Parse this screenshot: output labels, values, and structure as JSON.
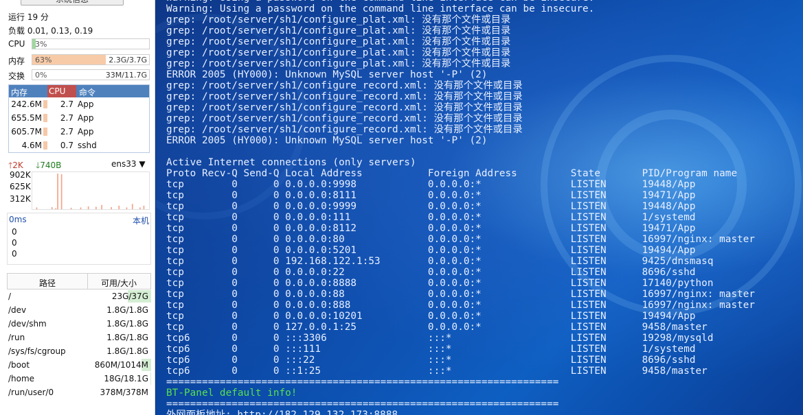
{
  "sidebar": {
    "system_button": "系统信息",
    "uptime": "运行 19 分",
    "load": "负载 0.01, 0.13, 0.19",
    "cpu": {
      "label": "CPU",
      "percent": "3%",
      "fill": 0.03
    },
    "mem": {
      "label": "内存",
      "percent": "63%",
      "value": "2.3G/3.7G",
      "fill": 0.63
    },
    "swap": {
      "label": "交换",
      "percent": "0%",
      "value": "33M/11.7G",
      "fill": 0.0
    },
    "proc_headers": [
      "内存",
      "CPU",
      "命令"
    ],
    "processes": [
      {
        "mem": "242.6M",
        "cpu": "2.7",
        "cmd": "App"
      },
      {
        "mem": "655.5M",
        "cpu": "2.7",
        "cmd": "App"
      },
      {
        "mem": "605.7M",
        "cpu": "2.7",
        "cmd": "App"
      },
      {
        "mem": "4.6M",
        "cpu": "0.7",
        "cmd": "sshd"
      }
    ],
    "net": {
      "up": "2K",
      "down": "740B",
      "interface": "ens33",
      "y_labels": [
        "902K",
        "625K",
        "312K"
      ],
      "bars": [
        0,
        0,
        0.05,
        0,
        0,
        0,
        0,
        0,
        0,
        0,
        0.06,
        0,
        0.03,
        1.0,
        0,
        0.98,
        0,
        0,
        0,
        0,
        0.04,
        0,
        0,
        0,
        0,
        0.05,
        0,
        0,
        0,
        0.08,
        0,
        0,
        0,
        0.07,
        0,
        0,
        0.12,
        0,
        0,
        0,
        0,
        0.06,
        0,
        0,
        0,
        0.1,
        0,
        0,
        0,
        0.05,
        0,
        0,
        0.15,
        0,
        0,
        0,
        0.05,
        0,
        0.1,
        0,
        0
      ]
    },
    "ping": {
      "ms": "0ms",
      "host": "本机",
      "values": [
        "0",
        "0",
        "0"
      ]
    },
    "disk": {
      "headers": [
        "路径",
        "可用/大小"
      ],
      "rows": [
        {
          "path": "/",
          "size": "23G/37G",
          "fill": 0.38
        },
        {
          "path": "/dev",
          "size": "1.8G/1.8G",
          "fill": 0.0
        },
        {
          "path": "/dev/shm",
          "size": "1.8G/1.8G",
          "fill": 0.0
        },
        {
          "path": "/run",
          "size": "1.8G/1.8G",
          "fill": 0.0
        },
        {
          "path": "/sys/fs/cgroup",
          "size": "1.8G/1.8G",
          "fill": 0.0
        },
        {
          "path": "/boot",
          "size": "860M/1014M",
          "fill": 0.15
        },
        {
          "path": "/home",
          "size": "18G/18.1G",
          "fill": 0.01
        },
        {
          "path": "/run/user/0",
          "size": "378M/378M",
          "fill": 0.0
        }
      ]
    }
  },
  "terminal": {
    "lines": [
      "Warning: Using a password on the command line interface can be insecure.",
      "Warning: Using a password on the command line interface can be insecure.",
      "grep: /root/server/sh1/configure_plat.xml: 没有那个文件或目录",
      "grep: /root/server/sh1/configure_plat.xml: 没有那个文件或目录",
      "grep: /root/server/sh1/configure_plat.xml: 没有那个文件或目录",
      "grep: /root/server/sh1/configure_plat.xml: 没有那个文件或目录",
      "grep: /root/server/sh1/configure_plat.xml: 没有那个文件或目录",
      "ERROR 2005 (HY000): Unknown MySQL server host '-P' (2)",
      "grep: /root/server/sh1/configure_record.xml: 没有那个文件或目录",
      "grep: /root/server/sh1/configure_record.xml: 没有那个文件或目录",
      "grep: /root/server/sh1/configure_record.xml: 没有那个文件或目录",
      "grep: /root/server/sh1/configure_record.xml: 没有那个文件或目录",
      "grep: /root/server/sh1/configure_record.xml: 没有那个文件或目录",
      "ERROR 2005 (HY000): Unknown MySQL server host '-P' (2)",
      "",
      "Active Internet connections (only servers)",
      "Proto Recv-Q Send-Q Local Address           Foreign Address         State       PID/Program name",
      "tcp        0      0 0.0.0.0:9998            0.0.0.0:*               LISTEN      19448/App",
      "tcp        0      0 0.0.0.0:8111            0.0.0.0:*               LISTEN      19471/App",
      "tcp        0      0 0.0.0.0:9999            0.0.0.0:*               LISTEN      19448/App",
      "tcp        0      0 0.0.0.0:111             0.0.0.0:*               LISTEN      1/systemd",
      "tcp        0      0 0.0.0.0:8112            0.0.0.0:*               LISTEN      19471/App",
      "tcp        0      0 0.0.0.0:80              0.0.0.0:*               LISTEN      16997/nginx: master",
      "tcp        0      0 0.0.0.0:5201            0.0.0.0:*               LISTEN      19494/App",
      "tcp        0      0 192.168.122.1:53        0.0.0.0:*               LISTEN      9425/dnsmasq",
      "tcp        0      0 0.0.0.0:22              0.0.0.0:*               LISTEN      8696/sshd",
      "tcp        0      0 0.0.0.0:8888            0.0.0.0:*               LISTEN      17140/python",
      "tcp        0      0 0.0.0.0:88              0.0.0.0:*               LISTEN      16997/nginx: master",
      "tcp        0      0 0.0.0.0:888             0.0.0.0:*               LISTEN      16997/nginx: master",
      "tcp        0      0 0.0.0.0:10201           0.0.0.0:*               LISTEN      19494/App",
      "tcp        0      0 127.0.0.1:25            0.0.0.0:*               LISTEN      9458/master",
      "tcp6       0      0 :::3306                 :::*                    LISTEN      19298/mysqld",
      "tcp6       0      0 :::111                  :::*                    LISTEN      1/systemd",
      "tcp6       0      0 :::22                   :::*                    LISTEN      8696/sshd",
      "tcp6       0      0 ::1:25                  :::*                    LISTEN      9458/master",
      "==================================================================",
      "BT-Panel default info!",
      "==================================================================",
      "外网面板地址: http://182.129.132.173:8888"
    ],
    "highlight_index": 36
  }
}
